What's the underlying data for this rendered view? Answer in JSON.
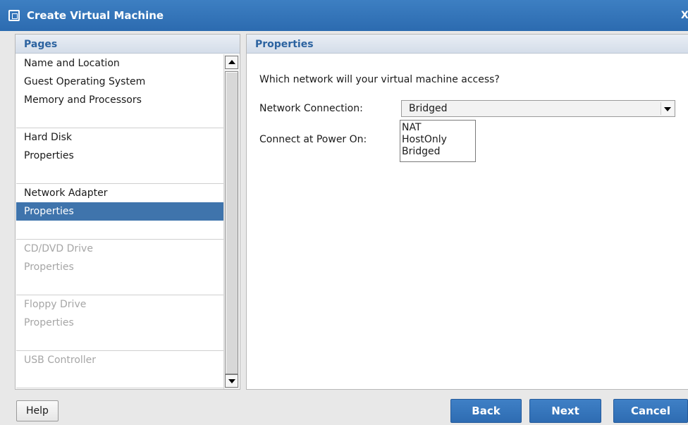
{
  "window": {
    "title": "Create Virtual Machine",
    "icon": "vm-icon",
    "close_label": "X"
  },
  "pages_panel": {
    "header": "Pages",
    "groups": [
      {
        "items": [
          {
            "label": "Name and Location",
            "state": "enabled"
          },
          {
            "label": "Guest Operating System",
            "state": "enabled"
          },
          {
            "label": "Memory and Processors",
            "state": "enabled"
          }
        ]
      },
      {
        "items": [
          {
            "label": "Hard Disk",
            "state": "enabled"
          },
          {
            "label": "Properties",
            "state": "enabled"
          }
        ]
      },
      {
        "items": [
          {
            "label": "Network Adapter",
            "state": "enabled"
          },
          {
            "label": "Properties",
            "state": "selected"
          }
        ]
      },
      {
        "items": [
          {
            "label": "CD/DVD Drive",
            "state": "disabled"
          },
          {
            "label": "Properties",
            "state": "disabled"
          }
        ]
      },
      {
        "items": [
          {
            "label": "Floppy Drive",
            "state": "disabled"
          },
          {
            "label": "Properties",
            "state": "disabled"
          }
        ]
      },
      {
        "items": [
          {
            "label": "USB Controller",
            "state": "disabled"
          }
        ]
      }
    ]
  },
  "properties_panel": {
    "header": "Properties",
    "question": "Which network will your virtual machine access?",
    "network_connection": {
      "label": "Network Connection:",
      "selected": "Bridged",
      "options": [
        "NAT",
        "HostOnly",
        "Bridged"
      ]
    },
    "connect_at_power_on": {
      "label": "Connect at Power On:"
    }
  },
  "footer": {
    "help": "Help",
    "back": "Back",
    "next": "Next",
    "cancel": "Cancel"
  },
  "colors": {
    "titlebar": "#2c6bb0",
    "selection": "#3f74ac",
    "header_text": "#2c63a0",
    "disabled_text": "#a6a6a6"
  }
}
